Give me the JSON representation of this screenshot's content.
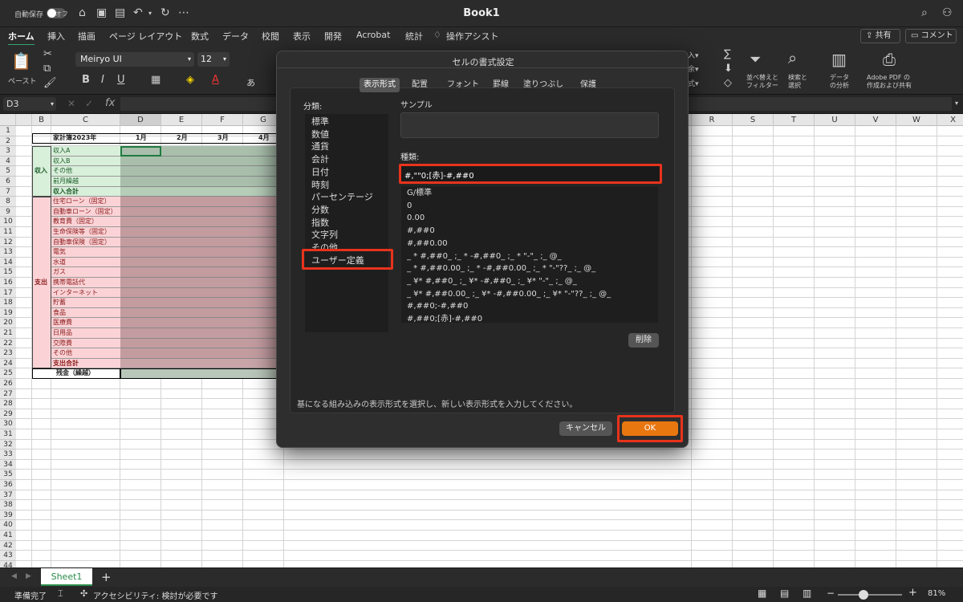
{
  "titlebar": {
    "autosave": "自動保存",
    "autosave_state": "オフ",
    "title": "Book1"
  },
  "ribbon_tabs": [
    "ホーム",
    "挿入",
    "描画",
    "ページ レイアウト",
    "数式",
    "データ",
    "校閲",
    "表示",
    "開発",
    "Acrobat",
    "統計"
  ],
  "tell_me": "操作アシスト",
  "share": "共有",
  "comment": "コメント",
  "ribbon": {
    "paste": "ペースト",
    "font_name": "Meiryo UI",
    "font_size": "12",
    "sort_filter": "並べ替えと\nフィルター",
    "find_select": "検索と\n選択",
    "analyze": "データ\nの分析",
    "adobe": "Adobe PDF の\n作成および共有"
  },
  "formula_bar": {
    "name_box": "D3",
    "fx": "fx",
    "value": ""
  },
  "columns_left": [
    "B",
    "C",
    "D",
    "E",
    "F",
    "G"
  ],
  "columns_right": [
    "R",
    "S",
    "T",
    "U",
    "V",
    "W",
    "X"
  ],
  "rows": [
    "1",
    "2",
    "3",
    "4",
    "5",
    "6",
    "7",
    "8",
    "9",
    "10",
    "11",
    "12",
    "13",
    "14",
    "15",
    "16",
    "17",
    "18",
    "19",
    "20",
    "21",
    "22",
    "23",
    "24",
    "25",
    "26",
    "27",
    "28",
    "29",
    "30",
    "31",
    "32",
    "33",
    "34",
    "35",
    "36",
    "37",
    "38",
    "39",
    "40",
    "41",
    "42",
    "43",
    "44"
  ],
  "sheet": {
    "title": "家計簿2023年",
    "months": [
      "1月",
      "2月",
      "3月",
      "4月"
    ],
    "income_label": "収入",
    "income_items": [
      "収入A",
      "収入B",
      "その他",
      "前月繰越"
    ],
    "income_total": "収入合計",
    "expense_label": "支出",
    "expense_items": [
      "住宅ローン（固定）",
      "自動車ローン（固定）",
      "教育費（固定）",
      "生命保険等（固定）",
      "自動車保険（固定）",
      "電気",
      "水道",
      "ガス",
      "携帯電話代",
      "インターネット",
      "貯蓄",
      "食品",
      "医療費",
      "日用品",
      "交際費",
      "その他"
    ],
    "expense_total": "支出合計",
    "balance": "残金（繰越）"
  },
  "sheet_tab": "Sheet1",
  "status": {
    "ready": "準備完了",
    "accessibility": "アクセシビリティ: 検討が必要です",
    "zoom": "81%"
  },
  "dialog": {
    "title": "セルの書式設定",
    "tabs": [
      "表示形式",
      "配置",
      "フォント",
      "罫線",
      "塗りつぶし",
      "保護"
    ],
    "category_label": "分類:",
    "categories": [
      "標準",
      "数値",
      "通貨",
      "会計",
      "日付",
      "時刻",
      "パーセンテージ",
      "分数",
      "指数",
      "文字列",
      "その他",
      "ユーザー定義"
    ],
    "sample_label": "サンプル",
    "type_label": "種類:",
    "type_value": "#,\"\"0;[赤]-#,##0",
    "formats": [
      "G/標準",
      "0",
      "0.00",
      "#,##0",
      "#,##0.00",
      "_ * #,##0_ ;_ * -#,##0_ ;_ * \"-\"_ ;_ @_",
      "_ * #,##0.00_ ;_ * -#,##0.00_ ;_ * \"-\"??_ ;_ @_",
      "_ ¥* #,##0_ ;_ ¥* -#,##0_ ;_ ¥* \"-\"_ ;_ @_",
      "_ ¥* #,##0.00_ ;_ ¥* -#,##0.00_ ;_ ¥* \"-\"??_ ;_ @_",
      "#,##0;-#,##0",
      "#,##0;[赤]-#,##0"
    ],
    "delete": "削除",
    "hint": "基になる組み込みの表示形式を選択し、新しい表示形式を入力してください。",
    "cancel": "キャンセル",
    "ok": "OK"
  }
}
